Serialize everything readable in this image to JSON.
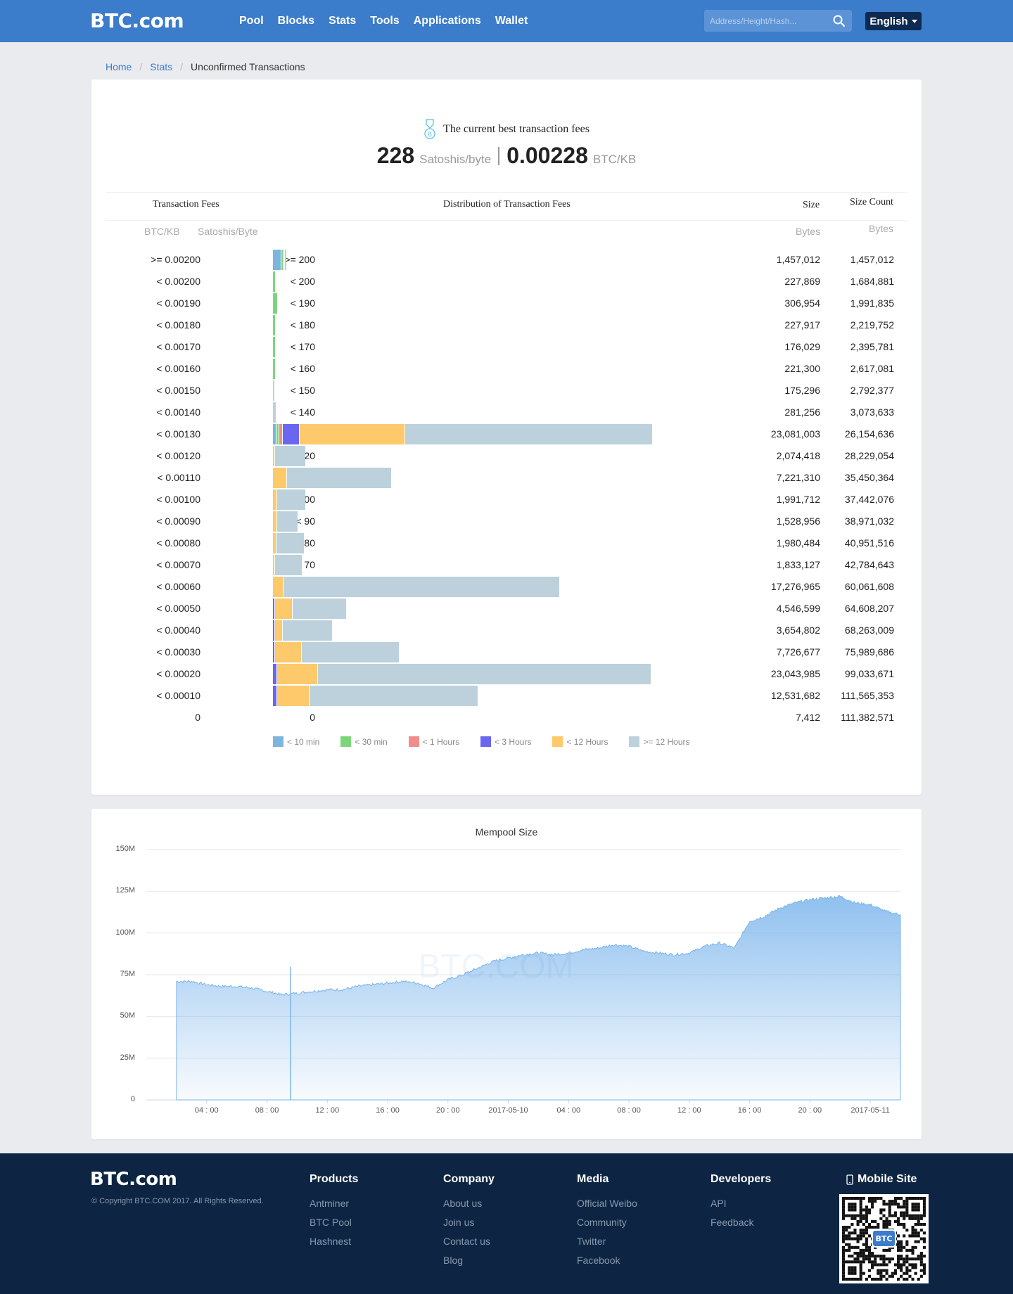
{
  "nav": {
    "logo": "BTC.com",
    "items": [
      "Pool",
      "Blocks",
      "Stats",
      "Tools",
      "Applications",
      "Wallet"
    ],
    "search_placeholder": "Address/Height/Hash...",
    "language": "English"
  },
  "breadcrumb": {
    "home": "Home",
    "stats": "Stats",
    "current": "Unconfirmed Transactions"
  },
  "best_fee": {
    "title": "The current best transaction fees",
    "sat_value": "228",
    "sat_unit": "Satoshis/byte",
    "btc_value": "0.00228",
    "btc_unit": "BTC/KB"
  },
  "table": {
    "header_fees": "Transaction Fees",
    "header_distribution": "Distribution of Transaction Fees",
    "header_size": "Size",
    "header_size_count": "Size Count",
    "sub_btc": "BTC/KB",
    "sub_sat": "Satoshis/Byte",
    "sub_size": "Bytes",
    "sub_count": "Bytes",
    "rows": [
      {
        "btc": ">= 0.00200",
        "sat": ">= 200",
        "size": "1,457,012",
        "count": "1,457,012",
        "dist": [
          0.8,
          0.2,
          0.0,
          0.0,
          0.05,
          0.05
        ]
      },
      {
        "btc": "< 0.00200",
        "sat": "< 200",
        "size": "227,869",
        "count": "1,684,881",
        "dist": [
          0.0,
          0.2,
          0.0,
          0.0,
          0.0,
          0.0
        ]
      },
      {
        "btc": "< 0.00190",
        "sat": "< 190",
        "size": "306,954",
        "count": "1,991,835",
        "dist": [
          0.0,
          0.4,
          0.0,
          0.0,
          0.0,
          0.0
        ]
      },
      {
        "btc": "< 0.00180",
        "sat": "< 180",
        "size": "227,917",
        "count": "2,219,752",
        "dist": [
          0.0,
          0.2,
          0.0,
          0.0,
          0.0,
          0.0
        ]
      },
      {
        "btc": "< 0.00170",
        "sat": "< 170",
        "size": "176,029",
        "count": "2,395,781",
        "dist": [
          0.0,
          0.2,
          0.0,
          0.0,
          0.0,
          0.0
        ]
      },
      {
        "btc": "< 0.00160",
        "sat": "< 160",
        "size": "221,300",
        "count": "2,617,081",
        "dist": [
          0.0,
          0.2,
          0.0,
          0.0,
          0.0,
          0.0
        ]
      },
      {
        "btc": "< 0.00150",
        "sat": "< 150",
        "size": "175,296",
        "count": "2,792,377",
        "dist": [
          0.0,
          0.0,
          0.0,
          0.0,
          0.0,
          0.15
        ]
      },
      {
        "btc": "< 0.00140",
        "sat": "< 140",
        "size": "281,256",
        "count": "3,073,633",
        "dist": [
          0.0,
          0.0,
          0.0,
          0.0,
          0.0,
          0.25
        ]
      },
      {
        "btc": "< 0.00130",
        "sat": "< 130",
        "size": "23,081,003",
        "count": "26,154,636",
        "dist": [
          0.3,
          0.3,
          0.3,
          1.6,
          9.8,
          22.9
        ]
      },
      {
        "btc": "< 0.00120",
        "sat": "< 120",
        "size": "2,074,418",
        "count": "28,229,054",
        "dist": [
          0.0,
          0.0,
          0.0,
          0.0,
          0.2,
          2.8
        ]
      },
      {
        "btc": "< 0.00110",
        "sat": "< 110",
        "size": "7,221,310",
        "count": "35,450,364",
        "dist": [
          0.0,
          0.0,
          0.0,
          0.0,
          1.3,
          9.7
        ]
      },
      {
        "btc": "< 0.00100",
        "sat": "< 100",
        "size": "1,991,712",
        "count": "37,442,076",
        "dist": [
          0.0,
          0.0,
          0.0,
          0.0,
          0.4,
          2.6
        ]
      },
      {
        "btc": "< 0.00090",
        "sat": "< 90",
        "size": "1,528,956",
        "count": "38,971,032",
        "dist": [
          0.0,
          0.0,
          0.0,
          0.0,
          0.4,
          1.9
        ]
      },
      {
        "btc": "< 0.00080",
        "sat": "< 80",
        "size": "1,980,484",
        "count": "40,951,516",
        "dist": [
          0.0,
          0.0,
          0.0,
          0.0,
          0.3,
          2.6
        ]
      },
      {
        "btc": "< 0.00070",
        "sat": "< 70",
        "size": "1,833,127",
        "count": "42,784,643",
        "dist": [
          0.0,
          0.0,
          0.0,
          0.0,
          0.2,
          2.5
        ]
      },
      {
        "btc": "< 0.00060",
        "sat": "< 60",
        "size": "17,276,965",
        "count": "60,061,608",
        "dist": [
          0.0,
          0.0,
          0.0,
          0.0,
          1.0,
          25.6
        ]
      },
      {
        "btc": "< 0.00050",
        "sat": "< 50",
        "size": "4,546,599",
        "count": "64,608,207",
        "dist": [
          0.0,
          0.0,
          0.0,
          0.2,
          1.6,
          5.0
        ]
      },
      {
        "btc": "< 0.00040",
        "sat": "< 40",
        "size": "3,654,802",
        "count": "68,263,009",
        "dist": [
          0.0,
          0.0,
          0.0,
          0.2,
          0.7,
          4.6
        ]
      },
      {
        "btc": "< 0.00030",
        "sat": "< 30",
        "size": "7,726,677",
        "count": "75,989,686",
        "dist": [
          0.0,
          0.0,
          0.0,
          0.2,
          2.5,
          9.0
        ]
      },
      {
        "btc": "< 0.00020",
        "sat": "< 20",
        "size": "23,043,985",
        "count": "99,033,671",
        "dist": [
          0.0,
          0.0,
          0.0,
          0.4,
          3.8,
          30.9
        ]
      },
      {
        "btc": "< 0.00010",
        "sat": "< 10",
        "size": "12,531,682",
        "count": "111,565,353",
        "dist": [
          0.0,
          0.0,
          0.0,
          0.4,
          3.0,
          15.6
        ]
      },
      {
        "btc": "0",
        "sat": "0",
        "size": "7,412",
        "count": "111,382,571",
        "dist": [
          0,
          0,
          0,
          0,
          0,
          0
        ]
      }
    ]
  },
  "legend": [
    {
      "label": "< 10 min",
      "color": "#7cb5dd"
    },
    {
      "label": "< 30 min",
      "color": "#7bd67b"
    },
    {
      "label": "< 1 Hours",
      "color": "#f28c8c"
    },
    {
      "label": "< 3 Hours",
      "color": "#6a66f0"
    },
    {
      "label": "< 12 Hours",
      "color": "#fdc96a"
    },
    {
      "label": ">= 12 Hours",
      "color": "#bcd1db"
    }
  ],
  "mempool_chart": {
    "title": "Mempool Size",
    "watermark": "BTC.COM",
    "chart_data": {
      "type": "area",
      "title": "Mempool Size",
      "yticks": [
        "150M",
        "125M",
        "100M",
        "75M",
        "50M",
        "25M",
        "0"
      ],
      "ylim": [
        0,
        150
      ],
      "xticks": [
        "04 : 00",
        "08 : 00",
        "12 : 00",
        "16 : 00",
        "20 : 00",
        "2017-05-10",
        "04 : 00",
        "08 : 00",
        "12 : 00",
        "16 : 00",
        "20 : 00",
        "2017-05-11"
      ],
      "x_hours": [
        2,
        3,
        4,
        5,
        6,
        7,
        8,
        9,
        10,
        11,
        12,
        13,
        14,
        15,
        16,
        17,
        18,
        19,
        20,
        21,
        22,
        23,
        24,
        25,
        26,
        27,
        28,
        29,
        30,
        31,
        32,
        33,
        34,
        35,
        36,
        37,
        38,
        39,
        40,
        41,
        42,
        43,
        44,
        45,
        46,
        47,
        48,
        49,
        50
      ],
      "values_m": [
        71,
        71,
        69,
        68,
        68,
        67,
        65,
        63,
        64,
        65,
        66,
        66,
        68,
        69,
        70,
        71,
        70,
        67,
        72,
        75,
        79,
        83,
        85,
        87,
        88,
        87,
        88,
        90,
        91,
        93,
        92,
        89,
        88,
        87,
        88,
        92,
        94,
        91,
        107,
        110,
        115,
        118,
        120,
        121,
        122,
        118,
        117,
        113,
        111
      ],
      "color": "#7cb5ec"
    }
  },
  "footer": {
    "logo": "BTC.com",
    "copyright": "© Copyright BTC.COM 2017. All Rights Reserved.",
    "columns": [
      {
        "title": "Products",
        "links": [
          "Antminer",
          "BTC Pool",
          "Hashnest"
        ]
      },
      {
        "title": "Company",
        "links": [
          "About us",
          "Join us",
          "Contact us",
          "Blog"
        ]
      },
      {
        "title": "Media",
        "links": [
          "Official Weibo",
          "Community",
          "Twitter",
          "Facebook"
        ]
      },
      {
        "title": "Developers",
        "links": [
          "API",
          "Feedback"
        ]
      }
    ],
    "mobile_site": "Mobile Site",
    "qr_label": "BTC"
  }
}
